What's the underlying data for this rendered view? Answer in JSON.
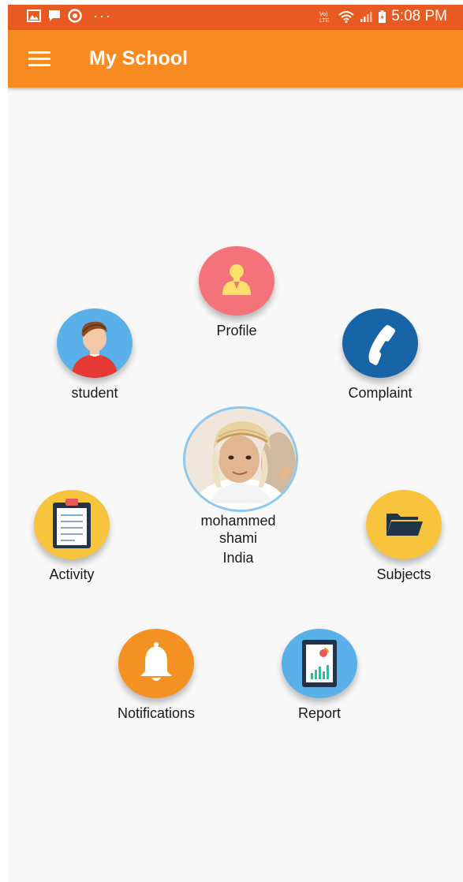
{
  "status_bar": {
    "time": "5:08 PM",
    "icons_left": [
      "gallery-icon",
      "message-icon",
      "chrome-icon",
      "more-dots-icon"
    ],
    "icons_right": [
      "volte-icon",
      "wifi-icon",
      "signal-icon",
      "battery-icon"
    ]
  },
  "app_bar": {
    "title": "My School"
  },
  "profile_center": {
    "name_line1": "mohammed",
    "name_line2": "shami",
    "country": "India"
  },
  "menu_items": {
    "profile": "Profile",
    "student": "student",
    "complaint": "Complaint",
    "activity": "Activity",
    "subjects": "Subjects",
    "notifications": "Notifications",
    "report": "Report"
  },
  "colors": {
    "status_bar": "#e85a22",
    "app_bar": "#f78a21",
    "profile_circle": "#f4727a",
    "student_circle": "#5ab0e8",
    "complaint_circle": "#1765a7",
    "activity_circle": "#f8c43e",
    "subjects_circle": "#f8c43e",
    "notifications_circle": "#f39223",
    "report_circle": "#5ab0e8"
  }
}
